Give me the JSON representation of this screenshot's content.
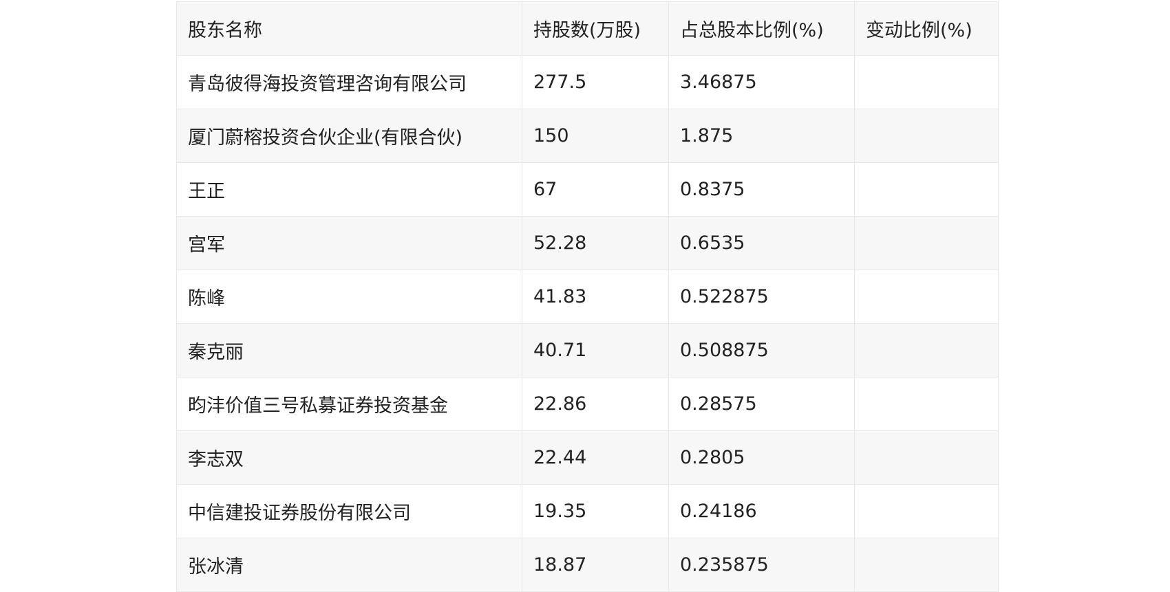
{
  "table": {
    "headers": [
      "股东名称",
      "持股数(万股)",
      "占总股本比例(%)",
      "变动比例(%)"
    ],
    "rows": [
      {
        "name": "青岛彼得海投资管理咨询有限公司",
        "shares": "277.5",
        "ratio": "3.46875",
        "change": ""
      },
      {
        "name": "厦门蔚榕投资合伙企业(有限合伙)",
        "shares": "150",
        "ratio": "1.875",
        "change": ""
      },
      {
        "name": "王正",
        "shares": "67",
        "ratio": "0.8375",
        "change": ""
      },
      {
        "name": "宫军",
        "shares": "52.28",
        "ratio": "0.6535",
        "change": ""
      },
      {
        "name": "陈峰",
        "shares": "41.83",
        "ratio": "0.522875",
        "change": ""
      },
      {
        "name": "秦克丽",
        "shares": "40.71",
        "ratio": "0.508875",
        "change": ""
      },
      {
        "name": "昀沣价值三号私募证券投资基金",
        "shares": "22.86",
        "ratio": "0.28575",
        "change": ""
      },
      {
        "name": "李志双",
        "shares": "22.44",
        "ratio": "0.2805",
        "change": ""
      },
      {
        "name": "中信建投证券股份有限公司",
        "shares": "19.35",
        "ratio": "0.24186",
        "change": ""
      },
      {
        "name": "张冰清",
        "shares": "18.87",
        "ratio": "0.235875",
        "change": ""
      }
    ]
  }
}
